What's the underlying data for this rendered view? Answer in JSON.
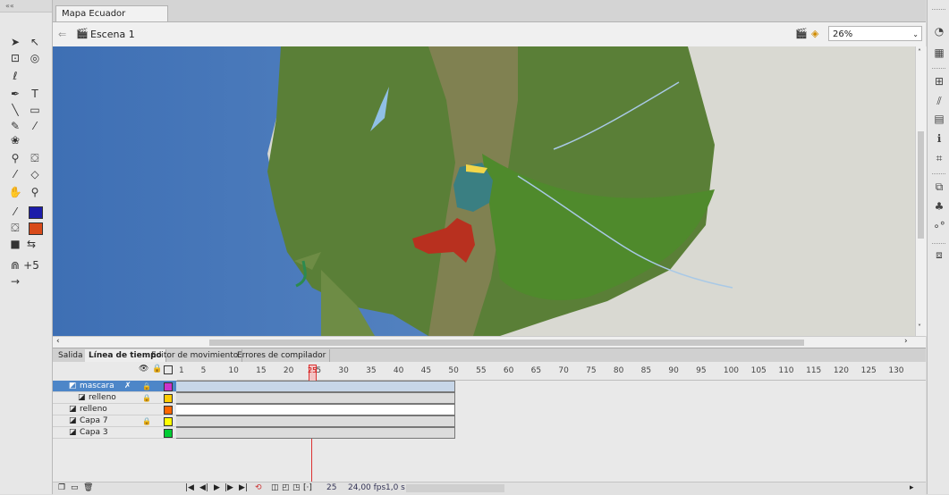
{
  "window": {
    "grip": "««"
  },
  "document": {
    "tab_title": "Mapa Ecuador Zn_Baja.fla",
    "tab_close": "×"
  },
  "scene": {
    "name": "Escena 1",
    "zoom": "26%"
  },
  "panel_tabs": [
    "Salida",
    "Línea de tiempo",
    "Editor de movimiento",
    "Errores de compilador"
  ],
  "timeline": {
    "frame_ticks": [
      "1",
      "5",
      "10",
      "15",
      "20",
      "25",
      "30",
      "35",
      "40",
      "45",
      "50",
      "55",
      "60",
      "65",
      "70",
      "75",
      "80",
      "85",
      "90",
      "95",
      "100",
      "105",
      "110",
      "115",
      "120",
      "125",
      "130"
    ],
    "playhead_frame": "25",
    "layers": [
      {
        "name": "mascara",
        "color": "#cc33cc"
      },
      {
        "name": "relleno",
        "color": "#ffcc00"
      },
      {
        "name": "relleno",
        "color": "#ff6600"
      },
      {
        "name": "Capa 7",
        "color": "#ffff00"
      },
      {
        "name": "Capa 3",
        "color": "#00cc33"
      }
    ],
    "status": {
      "current_frame": "25",
      "fps": "24,00 fps",
      "time": "1,0 s"
    }
  },
  "colors": {
    "stroke": "#1c1caa",
    "fill": "#d84a1a"
  }
}
